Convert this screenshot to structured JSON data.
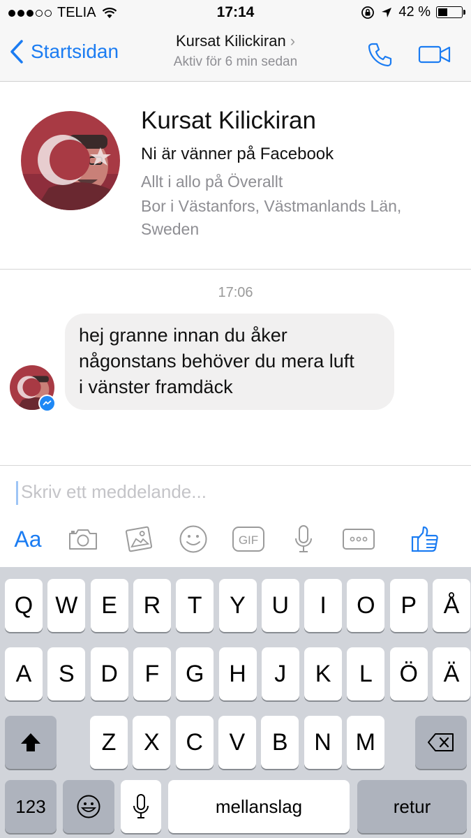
{
  "status_bar": {
    "carrier": "TELIA",
    "time": "17:14",
    "battery_percent": "42 %",
    "battery_level": 0.42,
    "signal_dots_filled": 3,
    "signal_dots_total": 5
  },
  "nav": {
    "back_label": "Startsidan",
    "contact_name": "Kursat Kilickiran",
    "active_status": "Aktiv för 6 min sedan",
    "icons": [
      "phone-icon",
      "video-camera-icon"
    ]
  },
  "profile": {
    "name": "Kursat Kilickiran",
    "friends_line": "Ni är vänner på Facebook",
    "work_line": "Allt i allo på Överallt",
    "location_line1": "Bor i Västanfors, Västmanlands Län,",
    "location_line2": "Sweden"
  },
  "conversation": {
    "timestamp": "17:06",
    "message_lines": [
      "hej granne innan du åker",
      "någonstans behöver du mera luft",
      "i vänster framdäck"
    ]
  },
  "composer": {
    "placeholder": "Skriv ett meddelande...",
    "aa_label": "Aa",
    "gif_label": "GIF",
    "tool_icons": [
      "camera-icon",
      "photo-gallery-icon",
      "emoji-icon",
      "gif-icon",
      "microphone-icon",
      "more-icon",
      "thumbs-up-icon"
    ]
  },
  "keyboard": {
    "row1": [
      "Q",
      "W",
      "E",
      "R",
      "T",
      "Y",
      "U",
      "I",
      "O",
      "P",
      "Å"
    ],
    "row2": [
      "A",
      "S",
      "D",
      "F",
      "G",
      "H",
      "J",
      "K",
      "L",
      "Ö",
      "Ä"
    ],
    "row3": [
      "Z",
      "X",
      "C",
      "V",
      "B",
      "N",
      "M"
    ],
    "numbers_label": "123",
    "space_label": "mellanslag",
    "return_label": "retur"
  },
  "colors": {
    "accent": "#1b7cf2",
    "bubble": "#f1f0f0",
    "keyboard_bg": "#d1d4da"
  }
}
